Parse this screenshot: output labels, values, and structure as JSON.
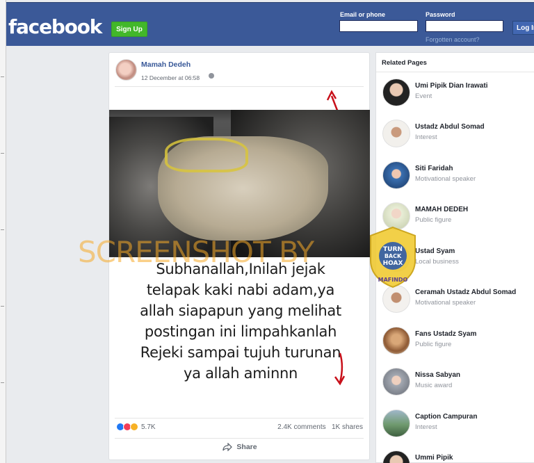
{
  "header": {
    "logo": "facebook",
    "signup_label": "Sign Up",
    "email_label": "Email or phone",
    "password_label": "Password",
    "email_value": "",
    "password_value": "",
    "forgot_label": "Forgotten account?",
    "login_label": "Log In"
  },
  "post": {
    "author": "Mamah Dedeh",
    "timestamp": "12 December at 06:58",
    "caption_lines": [
      "Subhanallah,Inilah jejak",
      "telapak kaki nabi adam,ya",
      "allah siapapun yang melihat",
      "postingan ini limpahkanlah",
      "Rejeki sampai tujuh turunan",
      "ya allah aminnn"
    ],
    "reaction_count": "5.7K",
    "comments": "2.4K comments",
    "shares": "1K shares",
    "share_label": "Share"
  },
  "overlay": {
    "watermark_text": "SCREENSHOT BY",
    "stamp_line1": "TURN",
    "stamp_line2": "BACK",
    "stamp_line3": "HOAX",
    "stamp_ring_top": "MASYARAKAT ANTI FITNAH INDONESIA",
    "stamp_ring_bottom": "MAFINDO"
  },
  "related": {
    "title": "Related Pages",
    "items": [
      {
        "name": "Umi Pipik Dian Irawati",
        "category": "Event",
        "color": "#2b2b2b"
      },
      {
        "name": "Ustadz Abdul Somad",
        "category": "Interest",
        "color": "#e8e6e2"
      },
      {
        "name": "Siti Faridah",
        "category": "Motivational speaker",
        "color": "#3a6fb0"
      },
      {
        "name": "MAMAH DEDEH",
        "category": "Public figure",
        "color": "#dfe6c8"
      },
      {
        "name": "Ustad Syam",
        "category": "Local business",
        "color": "#c9b58a"
      },
      {
        "name": "Ceramah Ustadz Abdul Somad",
        "category": "Motivational speaker",
        "color": "#d8d4cc"
      },
      {
        "name": "Fans Ustadz Syam",
        "category": "Public figure",
        "color": "#b07a4a"
      },
      {
        "name": "Nissa Sabyan",
        "category": "Music award",
        "color": "#8a8f99"
      },
      {
        "name": "Caption Campuran",
        "category": "Interest",
        "color": "#4f7f5a"
      },
      {
        "name": "Ummi Pipik",
        "category": "",
        "color": "#2b2b2b"
      }
    ]
  }
}
